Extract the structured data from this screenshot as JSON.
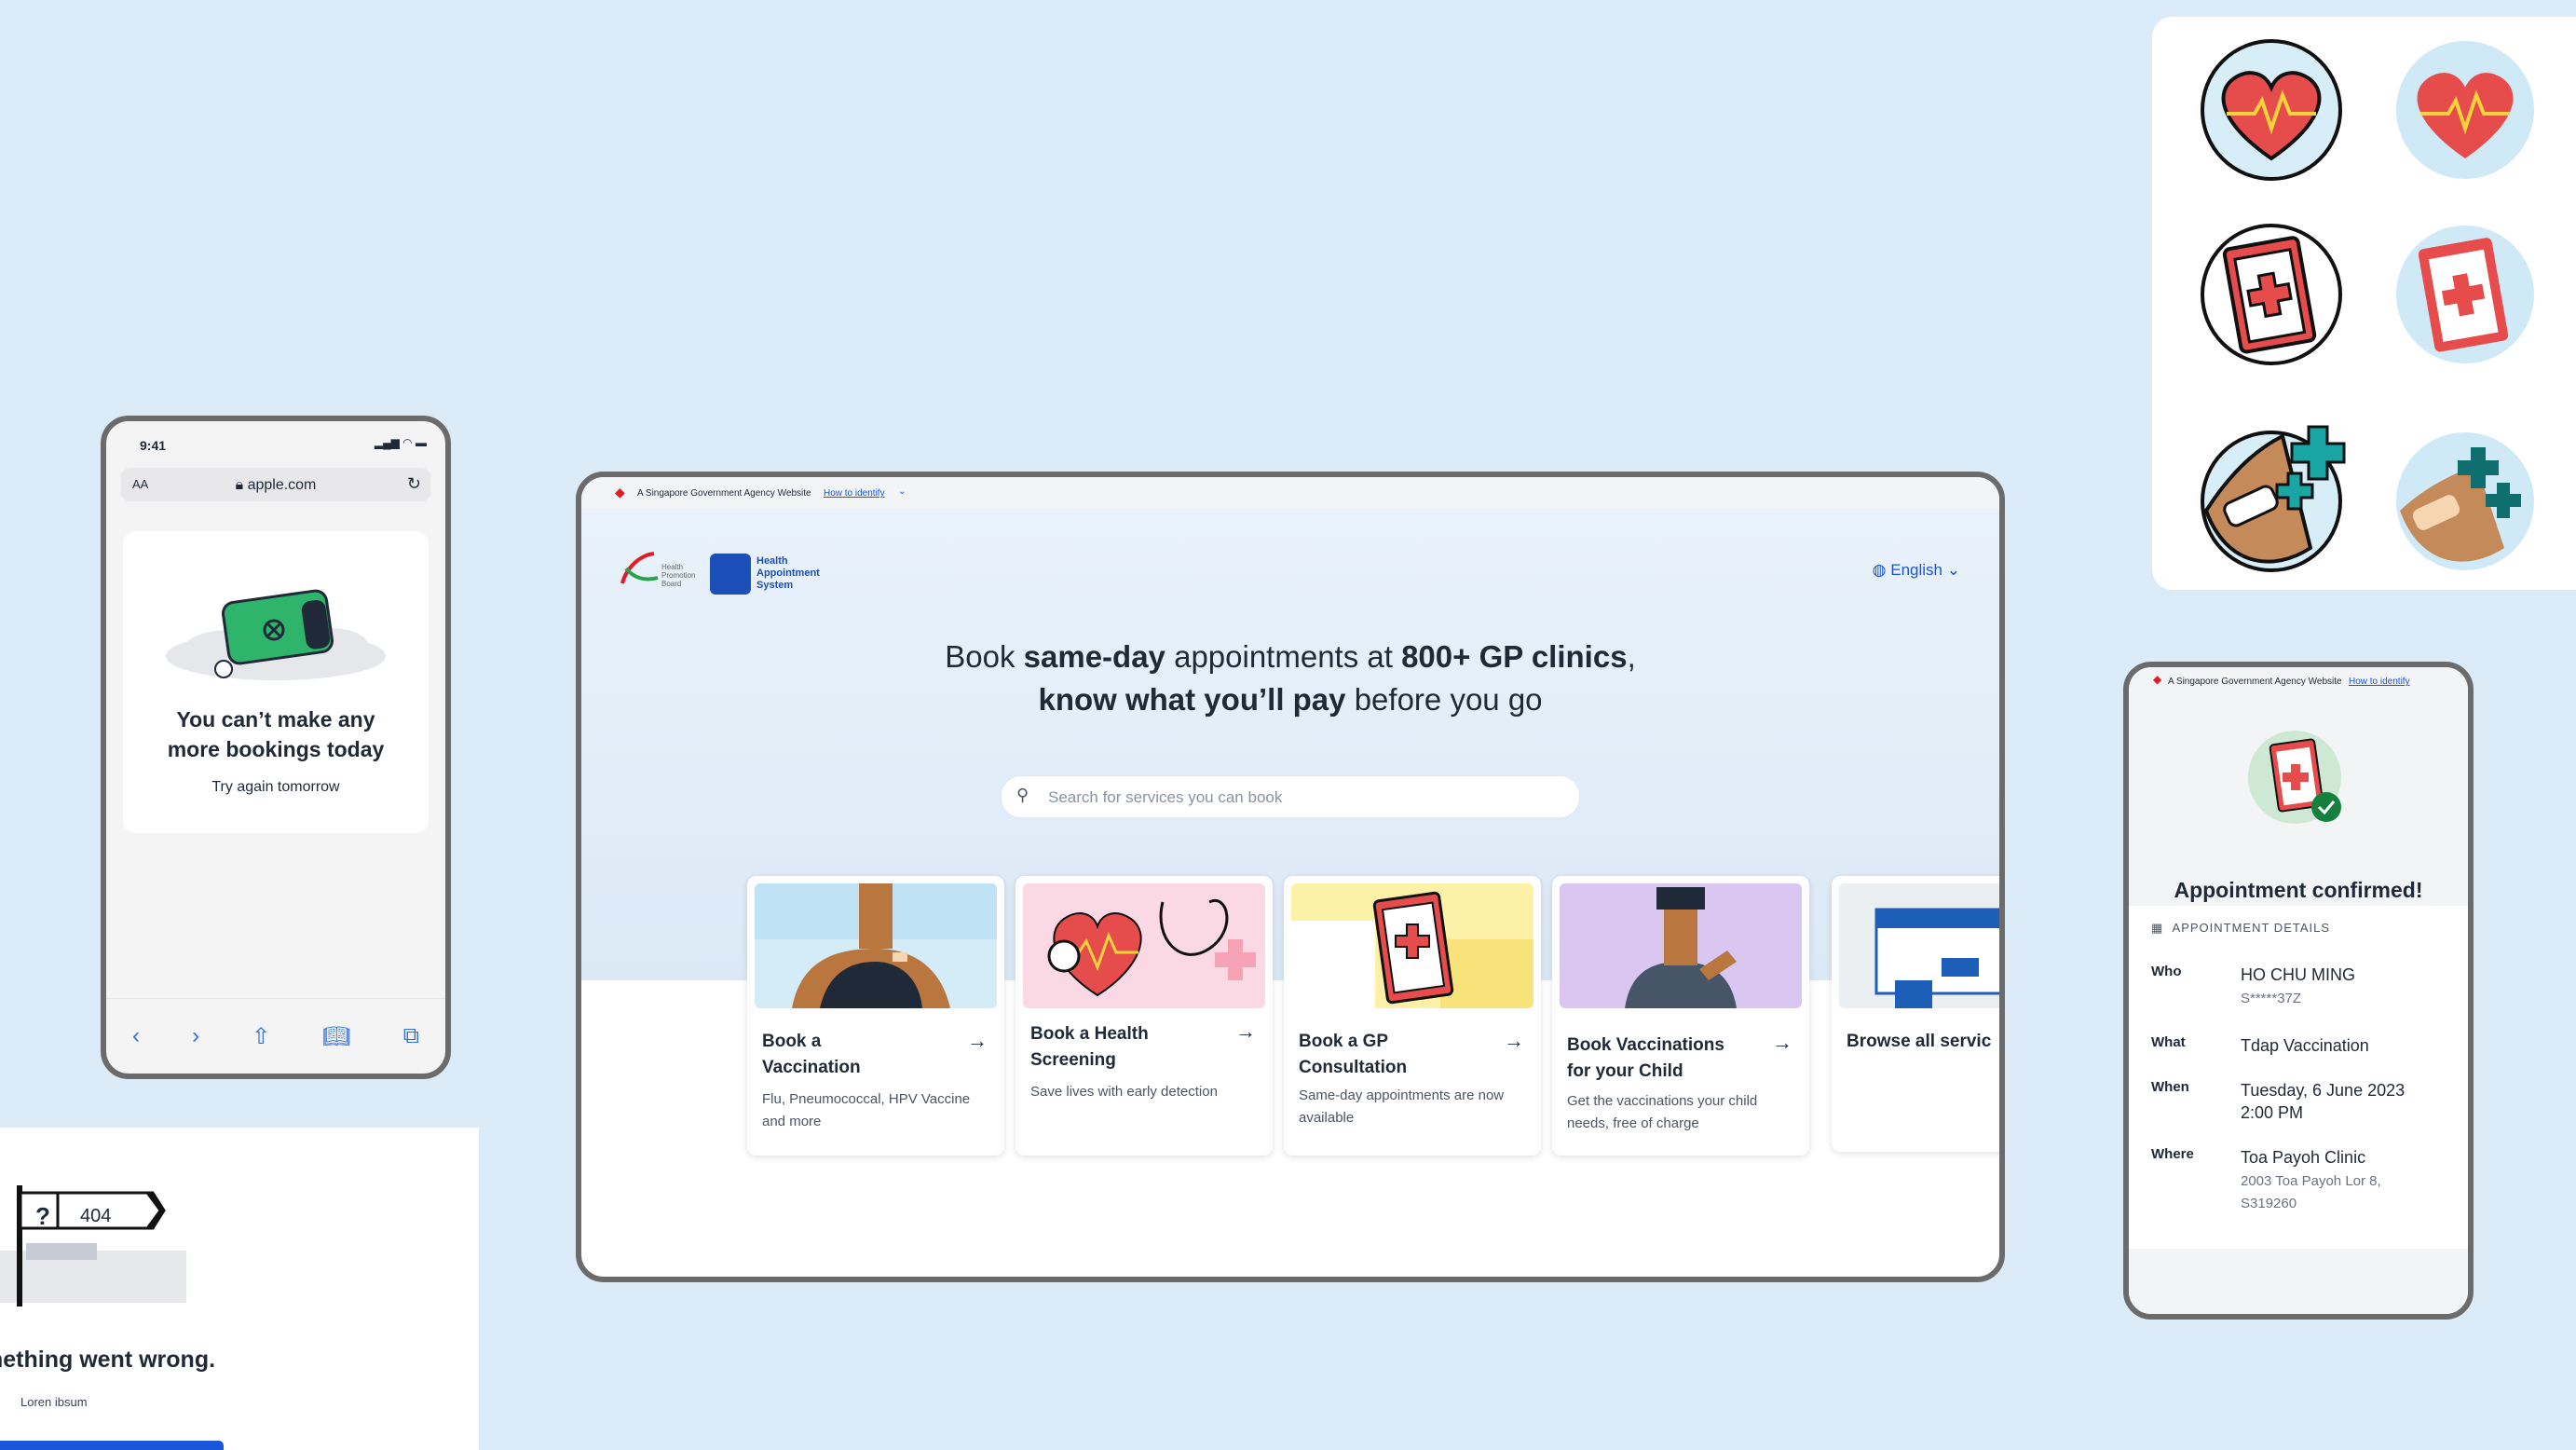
{
  "mobile_error": {
    "time": "9:41",
    "url_text_size": "AA",
    "url": "apple.com",
    "title_line1": "You can’t make any",
    "title_line2": "more bookings today",
    "subtitle": "Try again tomorrow"
  },
  "not_found": {
    "sign_symbol": "?",
    "sign_code": "404",
    "message": "nething went wrong.",
    "sub": "Loren ibsum"
  },
  "desktop": {
    "gov_banner": "A Singapore Government Agency Website",
    "gov_link": "How to identify",
    "hpb_logo": "Health Promotion Board",
    "has_logo_line1": "Health",
    "has_logo_line2": "Appointment",
    "has_logo_line3": "System",
    "language": "English",
    "headline_a": "Book ",
    "headline_b": "same-day",
    "headline_c": " appointments at ",
    "headline_d": "800+ GP clinics",
    "headline_e": ",",
    "headline_f": "know what you’ll pay",
    "headline_g": " before you go",
    "search_placeholder": "Search for services you can book",
    "services": [
      {
        "title_1": "Book a",
        "title_2": "Vaccination",
        "desc": "Flu, Pneumococcal, HPV Vaccine and more"
      },
      {
        "title_1": "Book a Health",
        "title_2": "Screening",
        "desc": "Save lives with early detection"
      },
      {
        "title_1": "Book a GP",
        "title_2": "Consultation",
        "desc": "Same-day appointments are now available"
      },
      {
        "title_1": "Book Vaccinations",
        "title_2": "for your Child",
        "desc": "Get the vaccinations your child needs, free of charge"
      },
      {
        "title_1": "Browse all servic"
      }
    ]
  },
  "mobile_confirm": {
    "gov_banner": "A Singapore Government Agency Website",
    "gov_link": "How to identify",
    "title": "Appointment confirmed!",
    "details_header": "APPOINTMENT DETAILS",
    "who_label": "Who",
    "who_name": "HO CHU MING",
    "who_id": "S*****37Z",
    "what_label": "What",
    "what_value": "Tdap Vaccination",
    "when_label": "When",
    "when_date": "Tuesday, 6 June 2023",
    "when_time": "2:00 PM",
    "where_label": "Where",
    "where_name": "Toa Payoh Clinic",
    "where_addr1": "2003 Toa Payoh Lor 8,",
    "where_addr2": "S319260"
  },
  "colors": {
    "background": "#dcebf8",
    "accent": "#1a56db",
    "heart": "#e74c4c",
    "teal": "#1aa5a5",
    "bandage": "#c48a5a"
  }
}
